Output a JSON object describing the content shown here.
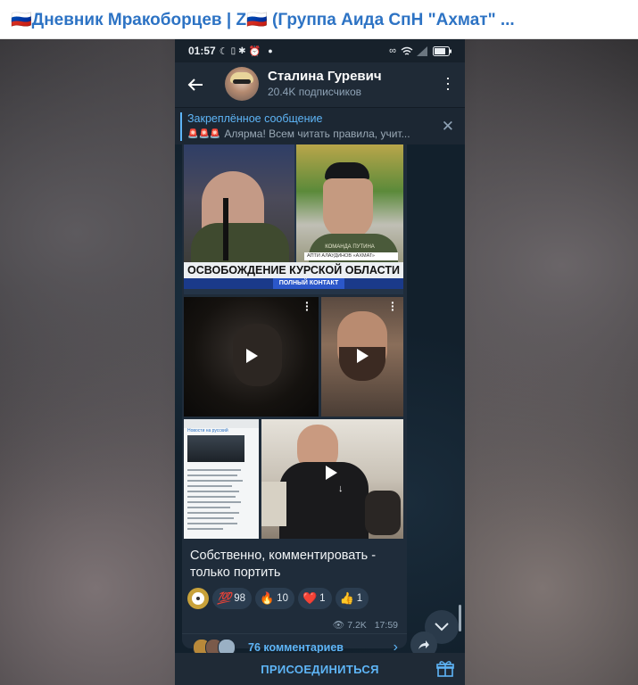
{
  "post_header": {
    "title": "🇷🇺Дневник Мракоборцев | Z🇷🇺 (Группа Аида СпН \"Ахмат\" ..."
  },
  "statusbar": {
    "time": "01:57",
    "icons": [
      "moon-icon",
      "vibrate-icon",
      "bluetooth-icon",
      "alarm-icon",
      "dot-icon",
      "link-icon",
      "wifi-icon",
      "signal-icon",
      "battery-icon"
    ]
  },
  "channel": {
    "name": "Сталина Гуревич",
    "subscribers": "20.4K подписчиков"
  },
  "pinned": {
    "label": "Закреплённое сообщение",
    "text": "Алярма! Всем читать правила, учит..."
  },
  "media": {
    "banner_text": "ОСВОБОЖДЕНИЕ КУРСКОЙ ОБЛАСТИ",
    "banner_sub": "ПОЛНЫЙ КОНТАКТ",
    "name_tag": "АПТИ АЛАУДИНОВ «АХМАТ»",
    "shirt_text": "КОМАНДА ПУТИНА",
    "doc_title": "Новости на русский"
  },
  "post": {
    "caption": "Собственно, комментировать - только портить",
    "reactions": [
      {
        "emoji": "💯",
        "count": "98"
      },
      {
        "emoji": "🔥",
        "count": "10"
      },
      {
        "emoji": "❤️",
        "count": "1"
      },
      {
        "emoji": "👍",
        "count": "1"
      }
    ],
    "views": "7.2K",
    "time": "17:59",
    "comments": "76 комментариев"
  },
  "footer": {
    "join": "ПРИСОЕДИНИТЬСЯ"
  },
  "colors": {
    "accent": "#5eb5f7",
    "title_blue": "#2d73c4"
  }
}
